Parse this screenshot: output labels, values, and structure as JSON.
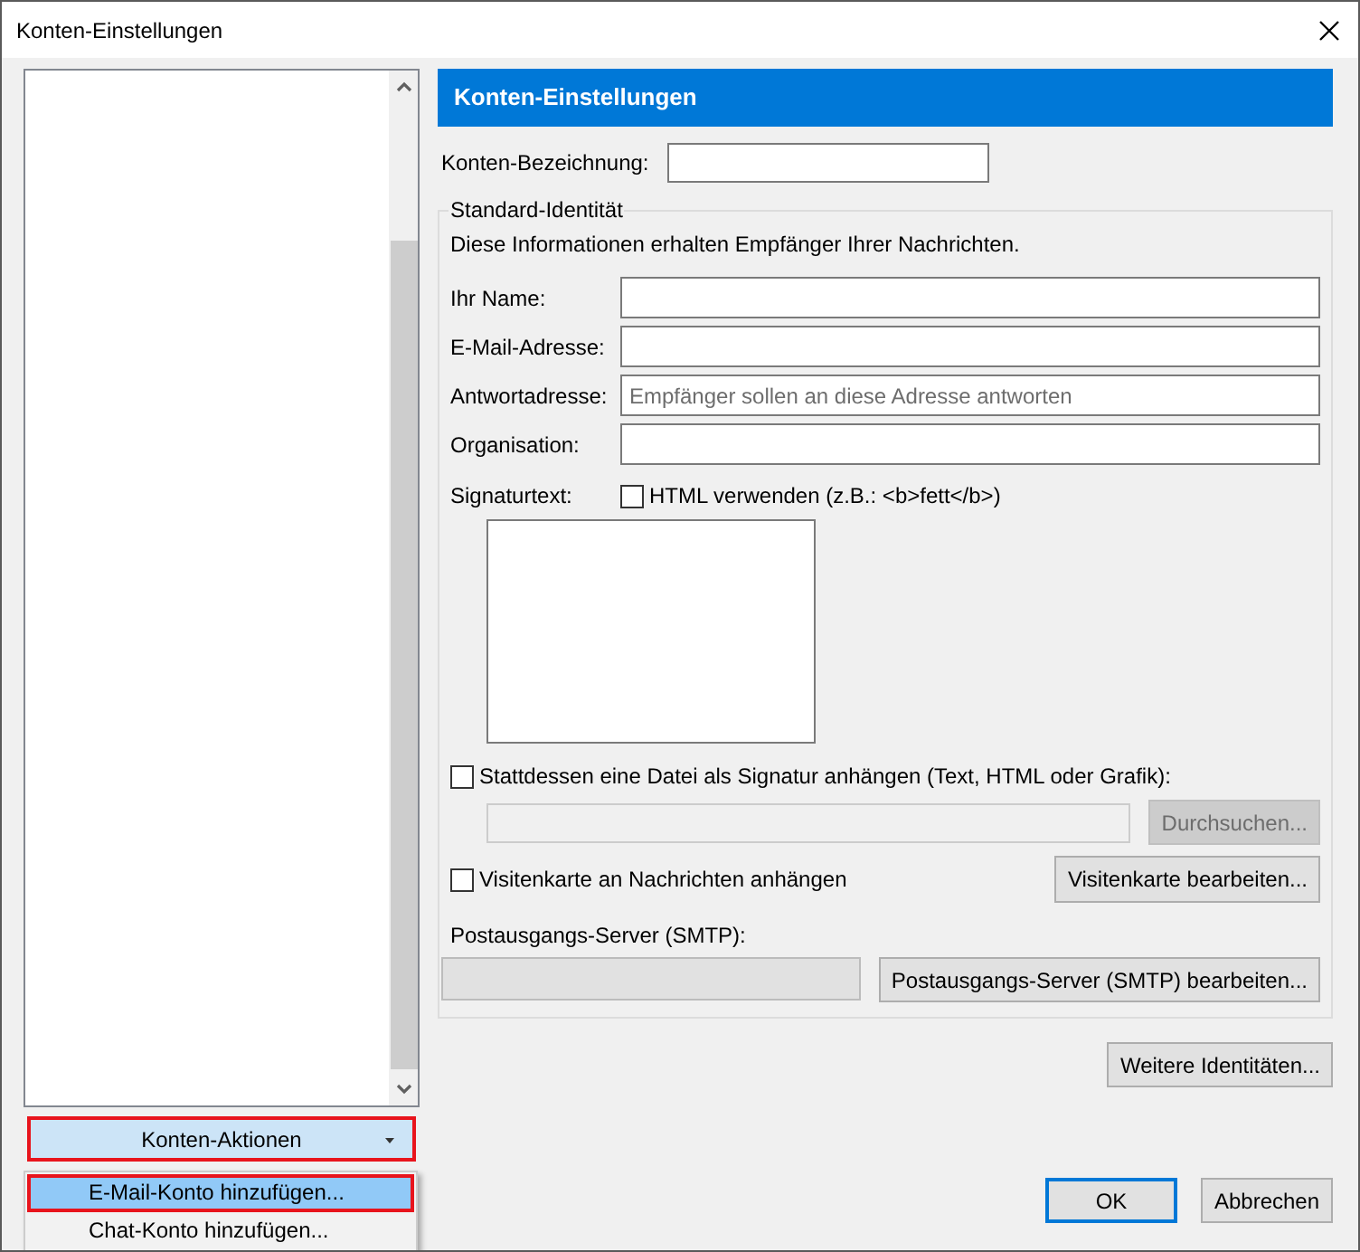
{
  "window": {
    "title": "Konten-Einstellungen"
  },
  "account_actions": {
    "label": "Konten-Aktionen",
    "marked": true
  },
  "actions_menu": [
    {
      "label": "E-Mail-Konto hinzufügen...",
      "selected": true,
      "marked": true
    },
    {
      "label": "Chat-Konto hinzufügen...",
      "selected": false,
      "marked": false
    }
  ],
  "panel": {
    "title": "Konten-Einstellungen",
    "account_name": {
      "label": "Konten-Bezeichnung:"
    },
    "identity": {
      "legend": "Standard-Identität",
      "description": "Diese Informationen erhalten Empfänger Ihrer Nachrichten.",
      "fields": [
        {
          "label": "Ihr Name:"
        },
        {
          "label": "E-Mail-Adresse:"
        },
        {
          "label": "Antwortadresse:",
          "placeholder": "Empfänger sollen an diese Adresse antworten"
        },
        {
          "label": "Organisation:"
        }
      ],
      "signature": {
        "label": "Signaturtext:",
        "html_option": {
          "label": "HTML verwenden (z.B.: <b>fett</b>)",
          "checked": false
        }
      },
      "signature_file": {
        "label": "Stattdessen eine Datei als Signatur anhängen (Text, HTML oder Grafik):",
        "checked": false,
        "browse_button": {
          "label": "Durchsuchen...",
          "disabled": true
        }
      },
      "vcard": {
        "label": "Visitenkarte an Nachrichten anhängen",
        "checked": false,
        "edit_button": "Visitenkarte bearbeiten..."
      },
      "smtp": {
        "label": "Postausgangs-Server (SMTP):",
        "disabled": true,
        "edit_button": "Postausgangs-Server (SMTP) bearbeiten..."
      }
    },
    "more_identities_button": "Weitere Identitäten..."
  },
  "buttons": [
    {
      "label": "OK",
      "default": true
    },
    {
      "label": "Abbrechen",
      "default": false
    }
  ]
}
